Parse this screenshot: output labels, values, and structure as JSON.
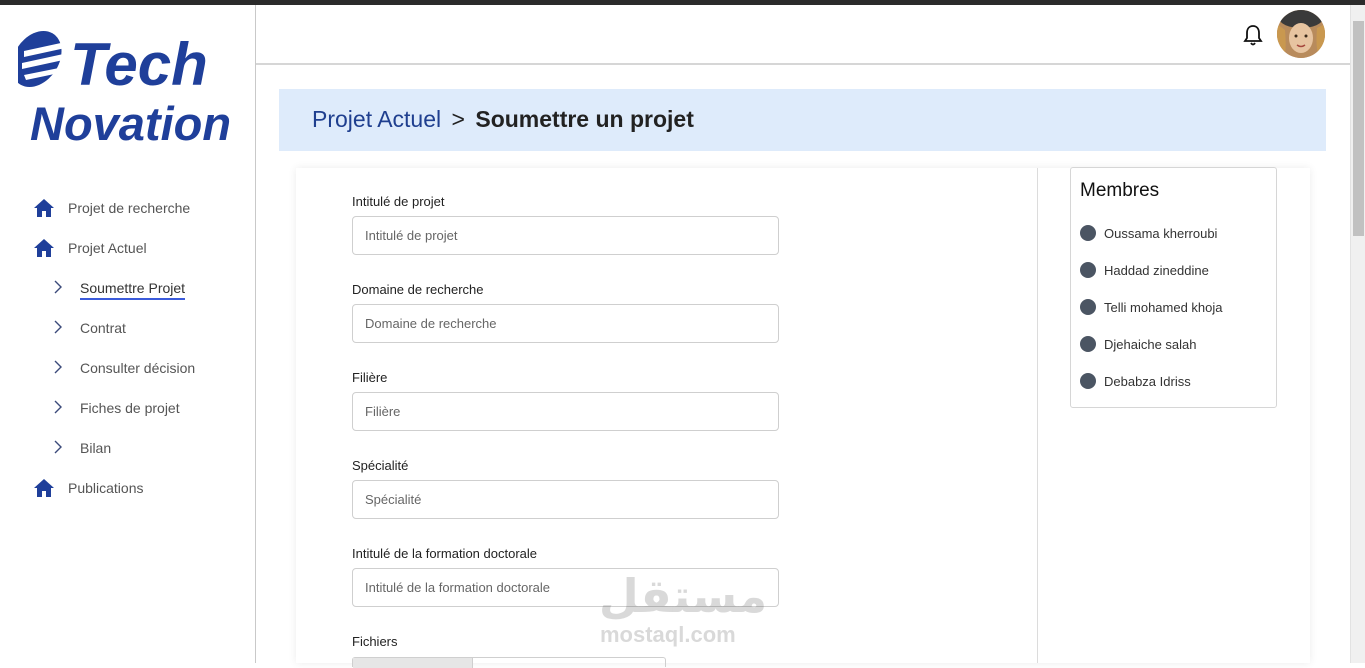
{
  "brand": {
    "line1": "Tech",
    "line2": "Novation",
    "color": "#1f3f9a"
  },
  "sidebar": {
    "items": [
      {
        "label": "Projet de recherche",
        "icon": "home-icon"
      },
      {
        "label": "Projet Actuel",
        "icon": "home-icon"
      },
      {
        "label": "Soumettre Projet",
        "icon": "chevron-right-icon",
        "active": true
      },
      {
        "label": "Contrat",
        "icon": "chevron-right-icon"
      },
      {
        "label": "Consulter décision",
        "icon": "chevron-right-icon"
      },
      {
        "label": "Fiches de projet",
        "icon": "chevron-right-icon"
      },
      {
        "label": "Bilan",
        "icon": "chevron-right-icon"
      },
      {
        "label": "Publications",
        "icon": "home-icon"
      }
    ]
  },
  "header": {
    "notification_icon": "bell-icon",
    "avatar_icon": "user-avatar"
  },
  "breadcrumb": {
    "parent": "Projet Actuel",
    "separator": ">",
    "current": "Soumettre un projet"
  },
  "form": {
    "fields": [
      {
        "label": "Intitulé de projet",
        "placeholder": "Intitulé de projet",
        "value": ""
      },
      {
        "label": "Domaine de recherche",
        "placeholder": "Domaine de recherche",
        "value": ""
      },
      {
        "label": "Filière",
        "placeholder": "Filière",
        "value": ""
      },
      {
        "label": "Spécialité",
        "placeholder": "Spécialité",
        "value": ""
      },
      {
        "label": "Intitulé de la formation doctorale",
        "placeholder": "Intitulé de la formation doctorale",
        "value": ""
      }
    ],
    "files_label": "Fichiers"
  },
  "members": {
    "title": "Membres",
    "list": [
      "Oussama kherroubi",
      "Haddad zineddine",
      "Telli mohamed khoja",
      "Djehaiche salah",
      "Debabza Idriss"
    ]
  },
  "watermark": {
    "arabic": "مستقل",
    "latin": "mostaql.com"
  },
  "colors": {
    "accent": "#1f3f9a",
    "breadcrumb_bg": "#deebfb",
    "active_underline": "#3b5bdb",
    "member_dot": "#4b5563"
  }
}
